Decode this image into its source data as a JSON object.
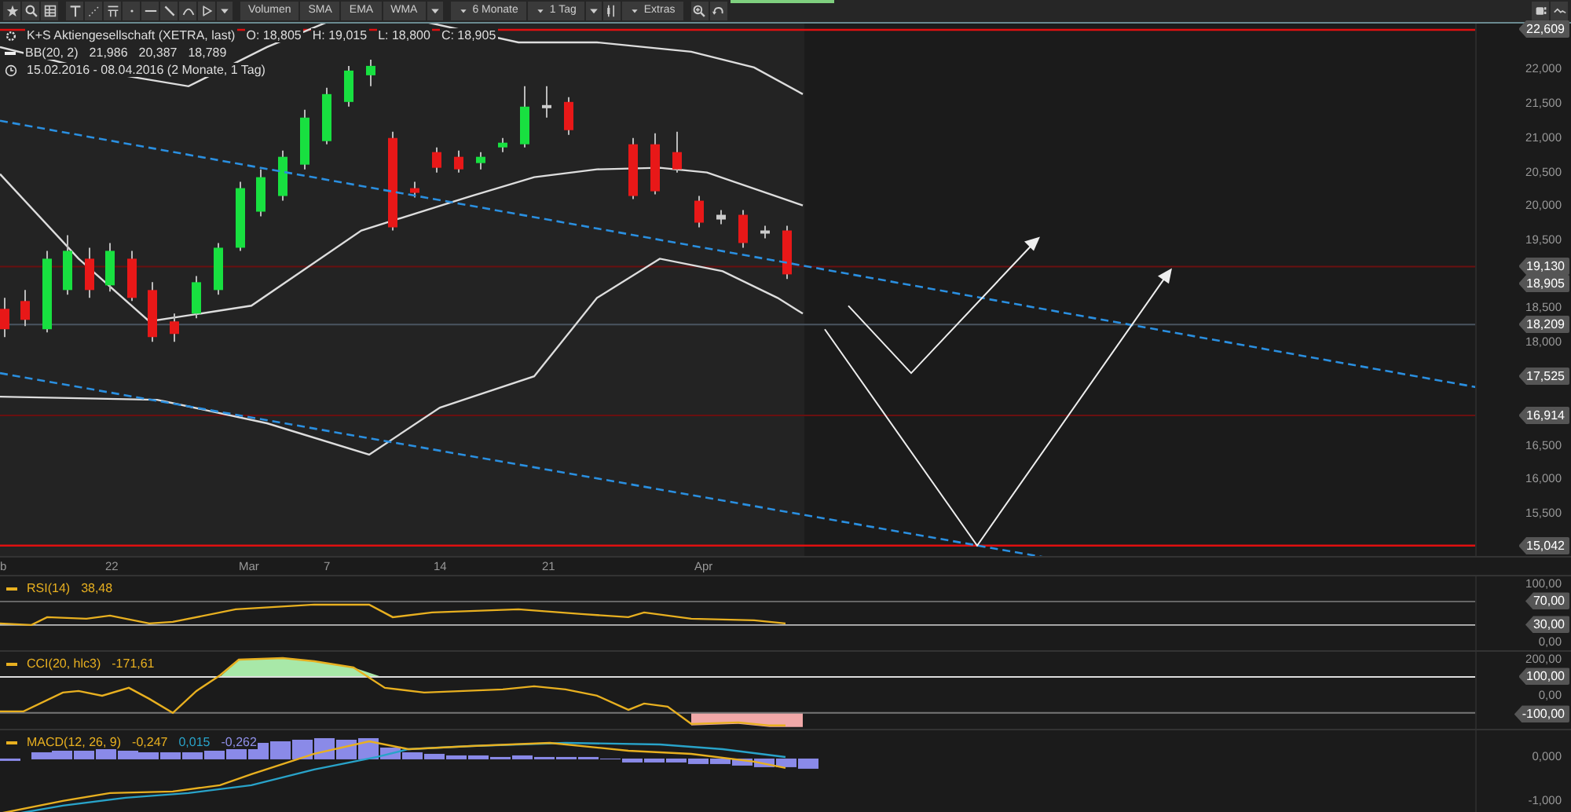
{
  "toolbar": {
    "indicators": [
      "Volumen",
      "SMA",
      "EMA",
      "WMA"
    ],
    "period": "6 Monate",
    "interval": "1 Tag",
    "extras": "Extras"
  },
  "legend": {
    "instrument": "K+S Aktiengesellschaft (XETRA, last)",
    "ohlc": [
      {
        "label": "O:",
        "value": "18,805"
      },
      {
        "label": "H:",
        "value": "19,015"
      },
      {
        "label": "L:",
        "value": "18,800"
      },
      {
        "label": "C:",
        "value": "18,905"
      }
    ],
    "bands": "BB(20, 2)",
    "band_values": [
      "21,986",
      "20,387",
      "18,789"
    ],
    "range": "15.02.2016 - 08.04.2016 (2 Monate, 1 Tag)"
  },
  "price_axis": {
    "ticks": [
      "22,000",
      "21,500",
      "21,000",
      "20,500",
      "20,000",
      "19,500",
      "18,500",
      "18,000",
      "16,500",
      "16,000",
      "15,500"
    ],
    "tags": [
      "22,609",
      "19,130",
      "18,905",
      "18,209",
      "17,525",
      "16,914",
      "15,042"
    ]
  },
  "date_axis": [
    "b",
    "22",
    "Mar",
    "7",
    "14",
    "21",
    "Apr"
  ],
  "rsi": {
    "label": "RSI(14)",
    "value": "38,48",
    "ticks": [
      "100,00",
      "0,00"
    ],
    "tags": [
      "70,00",
      "30,00"
    ]
  },
  "cci": {
    "label": "CCI(20, hlc3)",
    "value": "-171,61",
    "ticks": [
      "200,00",
      "0,00"
    ],
    "tags": [
      "100,00",
      "-100,00"
    ]
  },
  "macd": {
    "label": "MACD(12, 26, 9)",
    "values": [
      {
        "text": "-0,247",
        "color": "#e8b020"
      },
      {
        "text": "0,015",
        "color": "#29a3c9"
      },
      {
        "text": "-0,262",
        "color": "#8f8fe8"
      }
    ],
    "ticks": [
      "0,000",
      "-1,000"
    ]
  }
}
